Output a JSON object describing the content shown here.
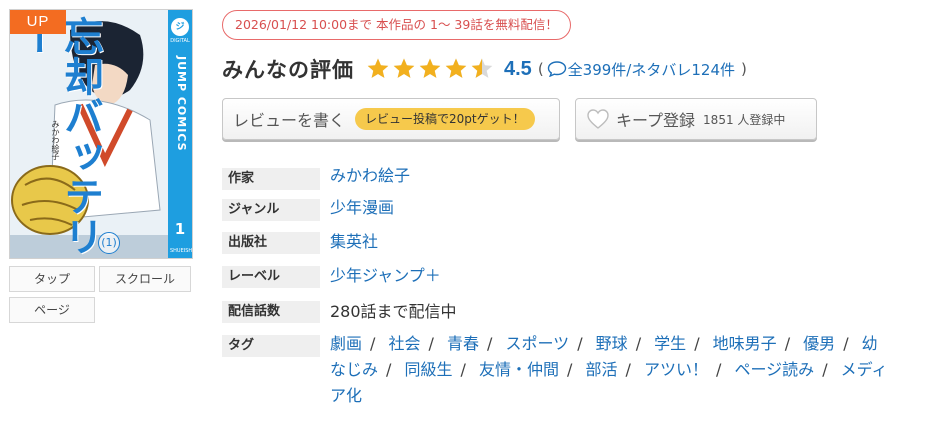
{
  "cover": {
    "badge": "UP",
    "title": "忘却バッテリー",
    "author": "みかわ絵子",
    "spine_label": "JUMP COMICS",
    "spine_logo": "ジ",
    "spine_digital": "DIGITAL",
    "volume": "1",
    "volume_circle": "(1)",
    "publisher_mark": "SHUEISHA",
    "colors": {
      "spine": "#1e9ee0",
      "badge": "#f36c21"
    }
  },
  "view_buttons": [
    "タップ",
    "スクロール",
    "ページ"
  ],
  "free_notice": "2026/01/12 10:00まで 本作品の 1〜 39話を無料配信！",
  "rating": {
    "title": "みんなの評価",
    "score": "4.5",
    "stars_filled": 4.5,
    "stars_total": 5,
    "star_color": "#f2b01e",
    "open_paren": "(",
    "count_text": "全399件/ネタバレ124件",
    "close_paren": ")",
    "icon": "speech-bubble-icon"
  },
  "buttons": {
    "review_label": "レビューを書く",
    "review_badge": "レビュー投稿で20ptゲット！",
    "keep_label": "キープ登録",
    "keep_count": "1851 人登録中",
    "keep_icon": "heart-icon"
  },
  "info": {
    "author_label": "作家",
    "author_value": "みかわ絵子",
    "genre_label": "ジャンル",
    "genre_value": "少年漫画",
    "publisher_label": "出版社",
    "publisher_value": "集英社",
    "label_label": "レーベル",
    "label_value": "少年ジャンプ＋",
    "episodes_label": "配信話数",
    "episodes_value": "280話まで配信中",
    "tags_label": "タグ",
    "tags": [
      "劇画",
      "社会",
      "青春",
      "スポーツ",
      "野球",
      "学生",
      "地味男子",
      "優男",
      "幼なじみ",
      "同級生",
      "友情・仲間",
      "部活",
      "アツい！",
      "ページ読み",
      "メディア化"
    ],
    "tag_separator": "/"
  },
  "link_color": "#1d6fb8"
}
